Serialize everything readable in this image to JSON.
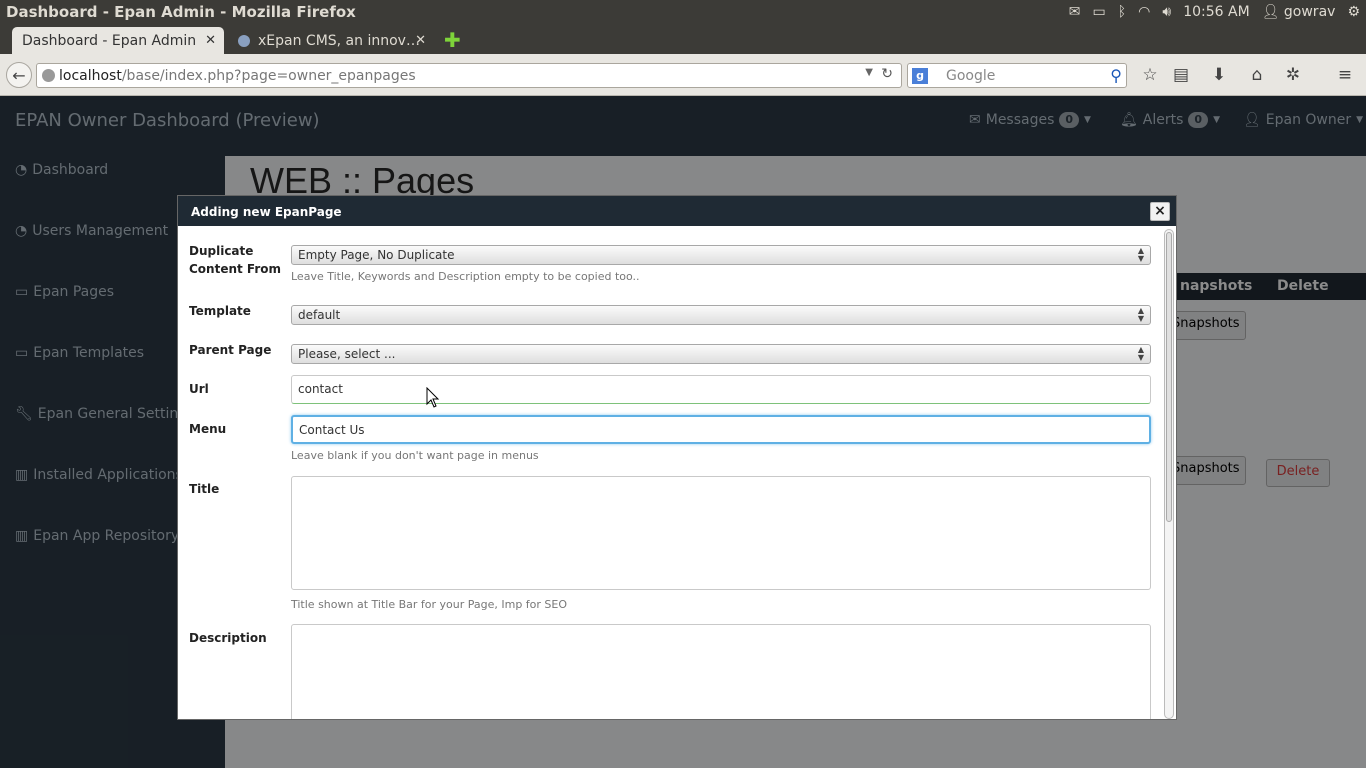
{
  "os": {
    "window_title": "Dashboard - Epan Admin - Mozilla Firefox",
    "time": "10:56 AM",
    "user": "gowrav"
  },
  "browser": {
    "tabs": [
      {
        "label": "Dashboard - Epan Admin",
        "active": true
      },
      {
        "label": "xEpan CMS, an innov…",
        "active": false
      }
    ],
    "url_host": "localhost",
    "url_path": "/base/index.php?page=owner_epanpages",
    "search_placeholder": "Google"
  },
  "app": {
    "brand": "EPAN Owner Dashboard (Preview)",
    "topnav": {
      "messages_label": "Messages",
      "messages_count": "0",
      "alerts_label": "Alerts",
      "alerts_count": "0",
      "user_label": "Epan Owner"
    },
    "sidebar": [
      {
        "label": "Dashboard",
        "icon": "dashboard-icon"
      },
      {
        "label": "Users Management",
        "icon": "dashboard-icon"
      },
      {
        "label": "Epan Pages",
        "icon": "desktop-icon"
      },
      {
        "label": "Epan Templates",
        "icon": "desktop-icon"
      },
      {
        "label": "Epan General Settings",
        "icon": "wrench-icon"
      },
      {
        "label": "Installed Applications",
        "icon": "bar-chart-icon"
      },
      {
        "label": "Epan App Repository",
        "icon": "bar-chart-icon"
      }
    ],
    "page_title": "WEB :: Pages",
    "table_headers": [
      "napshots",
      "Delete"
    ],
    "row_buttons": {
      "snapshots": "Snapshots",
      "delete": "Delete"
    }
  },
  "dialog": {
    "title": "Adding new EpanPage",
    "close_label": "×",
    "fields": {
      "duplicate_label_line1": "Duplicate",
      "duplicate_label_line2": "Content From",
      "duplicate_value": "Empty Page, No Duplicate",
      "duplicate_help": "Leave Title, Keywords and Description empty to be copied too..",
      "template_label": "Template",
      "template_value": "default",
      "parent_label": "Parent Page",
      "parent_value": "Please, select ...",
      "url_label": "Url",
      "url_value": "contact",
      "menu_label": "Menu",
      "menu_value": "Contact Us",
      "menu_help": "Leave blank if you don't want page in menus",
      "title_label": "Title",
      "title_value": "",
      "title_help": "Title shown at Title Bar for your Page, Imp for SEO",
      "description_label": "Description",
      "description_value": ""
    }
  },
  "colors": {
    "navbar_bg": "#25313b",
    "dialog_header": "#1f2a34",
    "focus_border": "#5fb0e4"
  }
}
